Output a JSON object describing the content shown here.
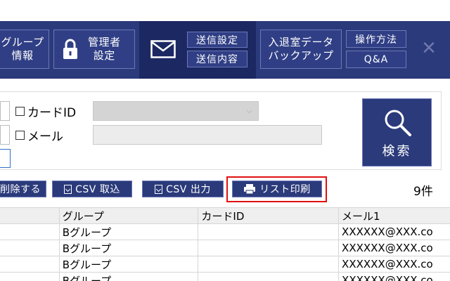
{
  "nav": {
    "group_info": "グループ\n情報",
    "admin_settings": "管理者\n設定",
    "send_settings": "送信設定",
    "send_content": "送信内容",
    "backup": "入退室データ\nバックアップ",
    "howto": "操作方法",
    "qa": "Q&A",
    "close": "✕"
  },
  "search": {
    "card_id_label": "カードID",
    "email_label": "メール",
    "search_button": "検索"
  },
  "actions": {
    "delete": "削除する",
    "csv_import": "CSV 取込",
    "csv_export": "CSV 出力",
    "print_list": "リスト印刷",
    "count": "9件"
  },
  "table": {
    "headers": [
      "",
      "グループ",
      "カードID",
      "メール1"
    ],
    "rows": [
      [
        "",
        "Bグループ",
        "",
        "XXXXXX@XXX.co"
      ],
      [
        "",
        "Bグループ",
        "",
        "XXXXXX@XXX.co"
      ],
      [
        "",
        "Bグループ",
        "",
        "XXXXXX@XXX.co"
      ],
      [
        "",
        "Bグループ",
        "",
        "XXXXXX@XXX.co"
      ]
    ]
  }
}
